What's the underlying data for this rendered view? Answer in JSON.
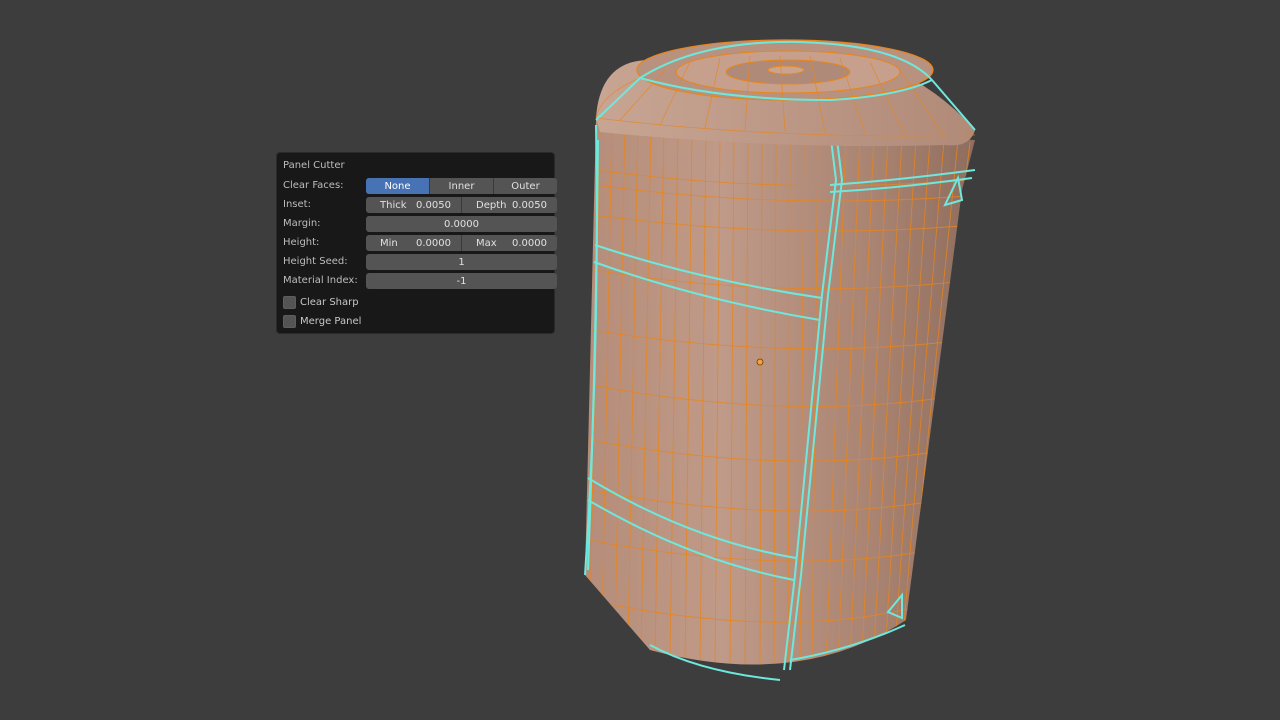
{
  "panel": {
    "title": "Panel Cutter",
    "clear_faces": {
      "label": "Clear Faces:",
      "options": [
        "None",
        "Inner",
        "Outer"
      ],
      "selected": "None"
    },
    "inset": {
      "label": "Inset:",
      "thick_label": "Thick",
      "thick_value": "0.0050",
      "depth_label": "Depth",
      "depth_value": "0.0050"
    },
    "margin": {
      "label": "Margin:",
      "value": "0.0000"
    },
    "height": {
      "label": "Height:",
      "min_label": "Min",
      "min_value": "0.0000",
      "max_label": "Max",
      "max_value": "0.0000"
    },
    "height_seed": {
      "label": "Height Seed:",
      "value": "1"
    },
    "material_index": {
      "label": "Material Index:",
      "value": "-1"
    },
    "clear_sharp": {
      "label": "Clear Sharp",
      "checked": false
    },
    "merge_panel": {
      "label": "Merge Panel",
      "checked": false
    }
  },
  "colors": {
    "background": "#3d3d3d",
    "mesh_face": "#b8927e",
    "wire_edge": "#e8851c",
    "seam_edge": "#6ee8dc",
    "selected_button": "#4772b3"
  }
}
